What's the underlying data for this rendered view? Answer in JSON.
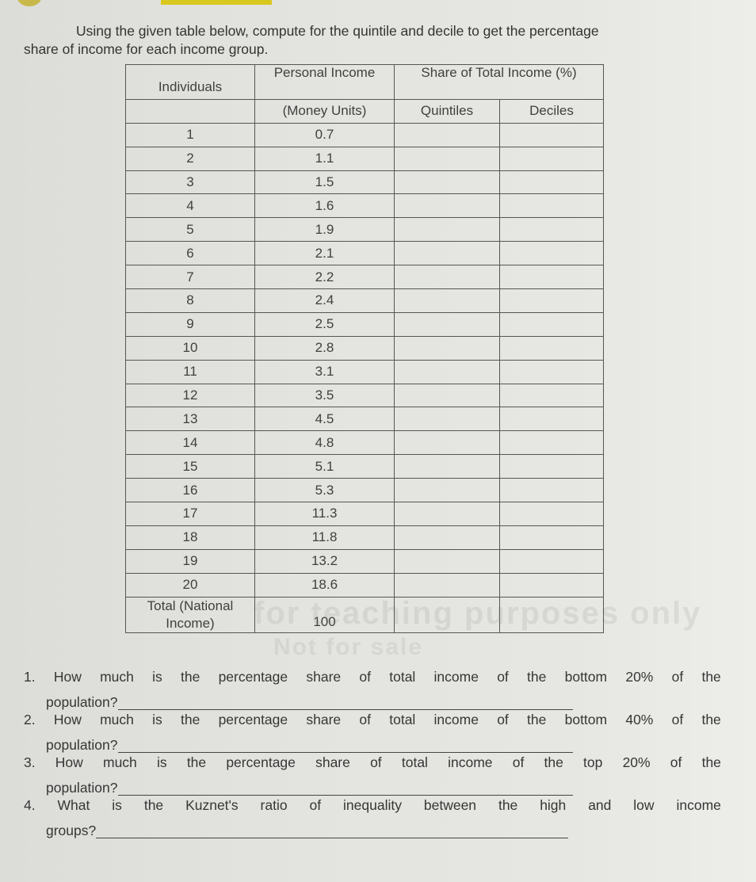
{
  "intro": {
    "line1": "Using the given table below, compute for the quintile and decile to get the percentage",
    "line2": "share of income for each income group."
  },
  "table": {
    "headers": {
      "individuals": "Individuals",
      "personal_income": "Personal Income",
      "money_units": "(Money Units)",
      "share": "Share of Total Income (%)",
      "quintiles": "Quintiles",
      "deciles": "Deciles"
    },
    "rows": [
      {
        "individual": "1",
        "income": "0.7",
        "quintile": "",
        "decile": ""
      },
      {
        "individual": "2",
        "income": "1.1",
        "quintile": "",
        "decile": ""
      },
      {
        "individual": "3",
        "income": "1.5",
        "quintile": "",
        "decile": ""
      },
      {
        "individual": "4",
        "income": "1.6",
        "quintile": "",
        "decile": ""
      },
      {
        "individual": "5",
        "income": "1.9",
        "quintile": "",
        "decile": ""
      },
      {
        "individual": "6",
        "income": "2.1",
        "quintile": "",
        "decile": ""
      },
      {
        "individual": "7",
        "income": "2.2",
        "quintile": "",
        "decile": ""
      },
      {
        "individual": "8",
        "income": "2.4",
        "quintile": "",
        "decile": ""
      },
      {
        "individual": "9",
        "income": "2.5",
        "quintile": "",
        "decile": ""
      },
      {
        "individual": "10",
        "income": "2.8",
        "quintile": "",
        "decile": ""
      },
      {
        "individual": "11",
        "income": "3.1",
        "quintile": "",
        "decile": ""
      },
      {
        "individual": "12",
        "income": "3.5",
        "quintile": "",
        "decile": ""
      },
      {
        "individual": "13",
        "income": "4.5",
        "quintile": "",
        "decile": ""
      },
      {
        "individual": "14",
        "income": "4.8",
        "quintile": "",
        "decile": ""
      },
      {
        "individual": "15",
        "income": "5.1",
        "quintile": "",
        "decile": ""
      },
      {
        "individual": "16",
        "income": "5.3",
        "quintile": "",
        "decile": ""
      },
      {
        "individual": "17",
        "income": "11.3",
        "quintile": "",
        "decile": ""
      },
      {
        "individual": "18",
        "income": "11.8",
        "quintile": "",
        "decile": ""
      },
      {
        "individual": "19",
        "income": "13.2",
        "quintile": "",
        "decile": ""
      },
      {
        "individual": "20",
        "income": "18.6",
        "quintile": "",
        "decile": ""
      }
    ],
    "total": {
      "label_line1": "Total (National",
      "label_line2": "Income)",
      "value": "100"
    }
  },
  "watermark": {
    "line1": "for teaching purposes only",
    "line2": "Not for sale"
  },
  "questions": [
    {
      "number": "1.",
      "words": [
        "How",
        "much",
        "is",
        "the",
        "percentage",
        "share",
        "of",
        "total",
        "income",
        "of",
        "the",
        "bottom",
        "20%",
        "of",
        "the"
      ],
      "continuation": "population?"
    },
    {
      "number": "2.",
      "words": [
        "How",
        "much",
        "is",
        "the",
        "percentage",
        "share",
        "of",
        "total",
        "income",
        "of",
        "the",
        "bottom",
        "40%",
        "of",
        "the"
      ],
      "continuation": "population?"
    },
    {
      "number": "3.",
      "words": [
        "How",
        "much",
        "is",
        "the",
        "percentage",
        "share",
        "of",
        "total",
        "income",
        "of",
        "the",
        "top",
        "20%",
        "of",
        "the"
      ],
      "continuation": "population?"
    },
    {
      "number": "4.",
      "words": [
        "What",
        "is",
        "the",
        "Kuznet's",
        "ratio",
        "of",
        "inequality",
        "between",
        "the",
        "high",
        "and",
        "low",
        "income"
      ],
      "continuation": "groups?"
    }
  ]
}
